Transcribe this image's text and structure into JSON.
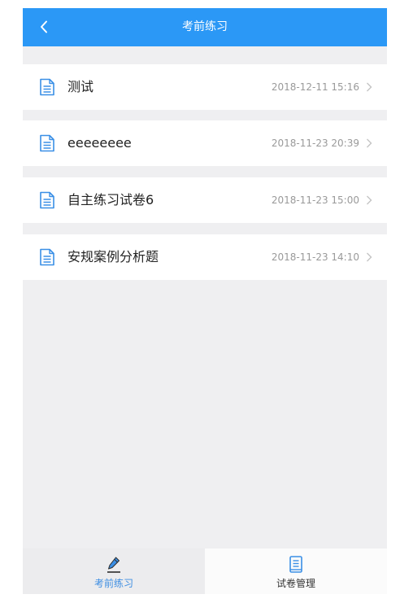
{
  "header": {
    "title": "考前练习",
    "back_icon": "chevron-left-icon"
  },
  "papers": [
    {
      "title": "测试",
      "date": "2018-12-11 15:16"
    },
    {
      "title": "eeeeeeee",
      "date": "2018-11-23 20:39"
    },
    {
      "title": "自主练习试卷6",
      "date": "2018-11-23 15:00"
    },
    {
      "title": "安规案例分析题",
      "date": "2018-11-23 14:10"
    }
  ],
  "tabs": [
    {
      "label": "考前练习",
      "icon": "pencil-icon",
      "active": true
    },
    {
      "label": "试卷管理",
      "icon": "book-icon",
      "active": false
    }
  ],
  "colors": {
    "header_bg": "#2b98f6",
    "page_bg": "#efeff1",
    "icon_blue": "#3a8fe6",
    "date_gray": "#9a9a9a"
  }
}
